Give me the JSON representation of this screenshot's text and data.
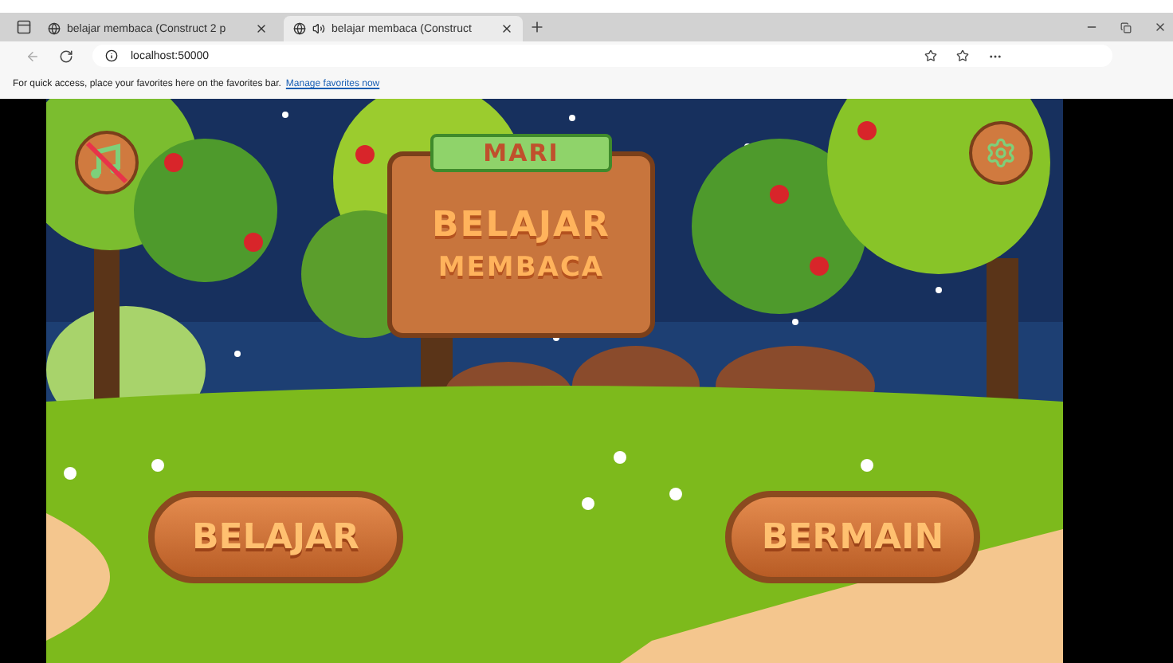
{
  "browser": {
    "tabs": [
      {
        "title": "belajar membaca (Construct 2 p",
        "selected": false,
        "audio": false
      },
      {
        "title": "belajar membaca (Construct",
        "selected": true,
        "audio": true
      }
    ],
    "address": "localhost:50000",
    "favorites_bar": {
      "message": "For quick access, place your favorites here on the favorites bar.",
      "link": "Manage favorites now"
    }
  },
  "game": {
    "music_muted": true,
    "title": {
      "ribbon": "MARI",
      "line_1": "BELAJAR",
      "line_2": "MEMBACA"
    },
    "buttons": [
      "BELAJAR",
      "BERMAIN"
    ]
  }
}
